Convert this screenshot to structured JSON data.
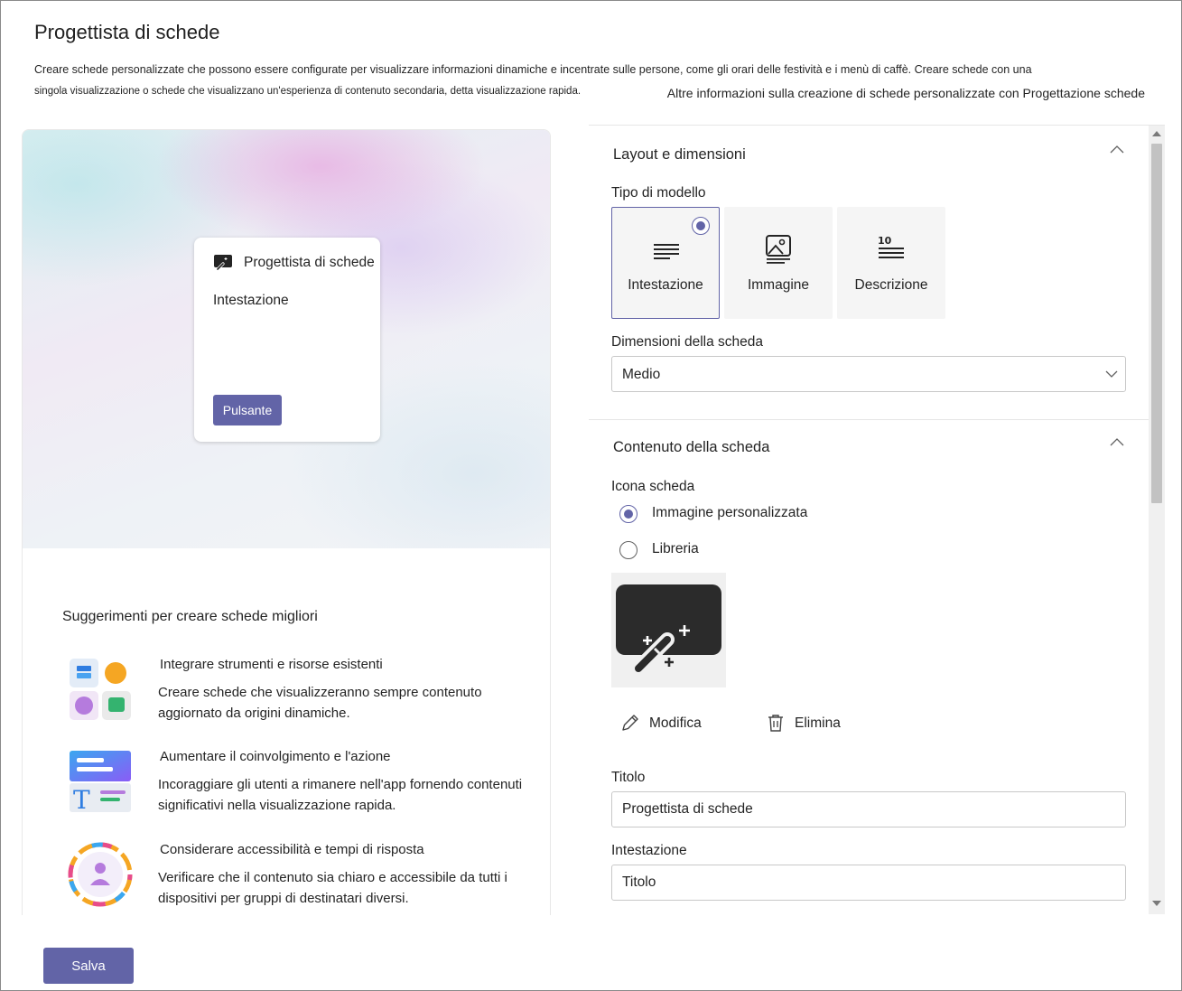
{
  "header": {
    "title": "Progettista di schede",
    "description_line1": "Creare schede personalizzate che possono essere configurate per visualizzare informazioni dinamiche e incentrate sulle persone, come gli orari delle festività e i menù di caffè. Creare schede con una",
    "description_line2": "singola visualizzazione o schede che visualizzano un'esperienza di contenuto secondaria, detta visualizzazione rapida.",
    "more_info_link": "Altre informazioni sulla creazione di schede personalizzate con Progettazione schede"
  },
  "preview": {
    "card_title": "Progettista di schede",
    "card_heading": "Intestazione",
    "card_button": "Pulsante"
  },
  "tips": {
    "title": "Suggerimenti per creare schede migliori",
    "items": [
      {
        "heading": "Integrare strumenti e risorse esistenti",
        "text": "Creare schede che visualizzeranno sempre contenuto aggiornato da origini dinamiche."
      },
      {
        "heading": "Aumentare il coinvolgimento e l'azione",
        "text": "Incoraggiare gli utenti a rimanere nell'app fornendo contenuti significativi nella visualizzazione rapida."
      },
      {
        "heading": "Considerare accessibilità e tempi di risposta",
        "text": "Verificare che il contenuto sia chiaro e accessibile da tutti i dispositivi per gruppi di destinatari diversi."
      }
    ]
  },
  "layout_section": {
    "title": "Layout e dimensioni",
    "template_type_label": "Tipo di modello",
    "templates": [
      {
        "label": "Intestazione",
        "icon": "heading-lines-icon",
        "selected": true
      },
      {
        "label": "Immagine",
        "icon": "image-icon",
        "selected": false
      },
      {
        "label": "Descrizione",
        "icon": "description-icon",
        "selected": false
      }
    ],
    "card_size_label": "Dimensioni della scheda",
    "card_size_value": "Medio"
  },
  "content_section": {
    "title": "Contenuto della scheda",
    "card_icon_label": "Icona scheda",
    "icon_options": [
      {
        "label": "Immagine personalizzata",
        "selected": true
      },
      {
        "label": "Libreria",
        "selected": false
      }
    ],
    "edit_label": "Modifica",
    "delete_label": "Elimina",
    "title_label": "Titolo",
    "title_value": "Progettista di schede",
    "heading_label": "Intestazione",
    "heading_value": "Titolo"
  },
  "footer": {
    "save_label": "Salva"
  },
  "colors": {
    "accent": "#6264a7",
    "icon_dark": "#242424"
  }
}
